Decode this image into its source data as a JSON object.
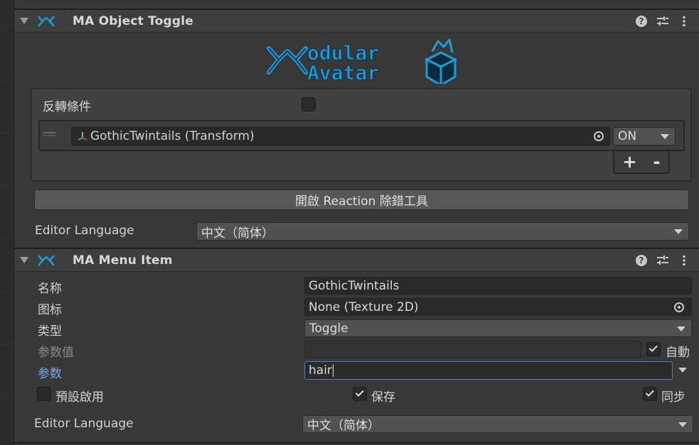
{
  "object_toggle": {
    "title": "MA Object Toggle",
    "logo_text_line1": "odular",
    "logo_text_line2": "Avatar",
    "invert_condition_label": "反轉條件",
    "invert_condition_checked": false,
    "entries": [
      {
        "object": "GothicTwintails (Transform)",
        "state": "ON"
      }
    ],
    "add_label": "+",
    "remove_label": "-",
    "debug_button_label": "開啟 Reaction 除錯工具",
    "editor_language_label": "Editor Language",
    "editor_language_value": "中文（简体）"
  },
  "menu_item": {
    "title": "MA Menu Item",
    "name_label": "名称",
    "name_value": "GothicTwintails",
    "icon_label": "图标",
    "icon_value": "None (Texture 2D)",
    "type_label": "类型",
    "type_value": "Toggle",
    "param_value_label": "参数值",
    "param_value_value": "",
    "auto_label": "自動",
    "auto_checked": true,
    "parameter_label": "参数",
    "parameter_value": "hair",
    "default_on_label": "預設啟用",
    "default_on_checked": false,
    "saved_label": "保存",
    "saved_checked": true,
    "synced_label": "同步",
    "synced_checked": true,
    "editor_language_label": "Editor Language",
    "editor_language_value": "中文（简体）"
  },
  "colors": {
    "accent_blue": "#1f9bd7",
    "focus_border": "#4c7fc4",
    "panel_bg": "#383838"
  },
  "icons": [
    "ma-logo-icon",
    "help-icon",
    "presets-icon",
    "kebab-menu-icon",
    "transform-icon",
    "object-picker-icon",
    "dropdown-arrow-icon",
    "checkmark-icon"
  ]
}
